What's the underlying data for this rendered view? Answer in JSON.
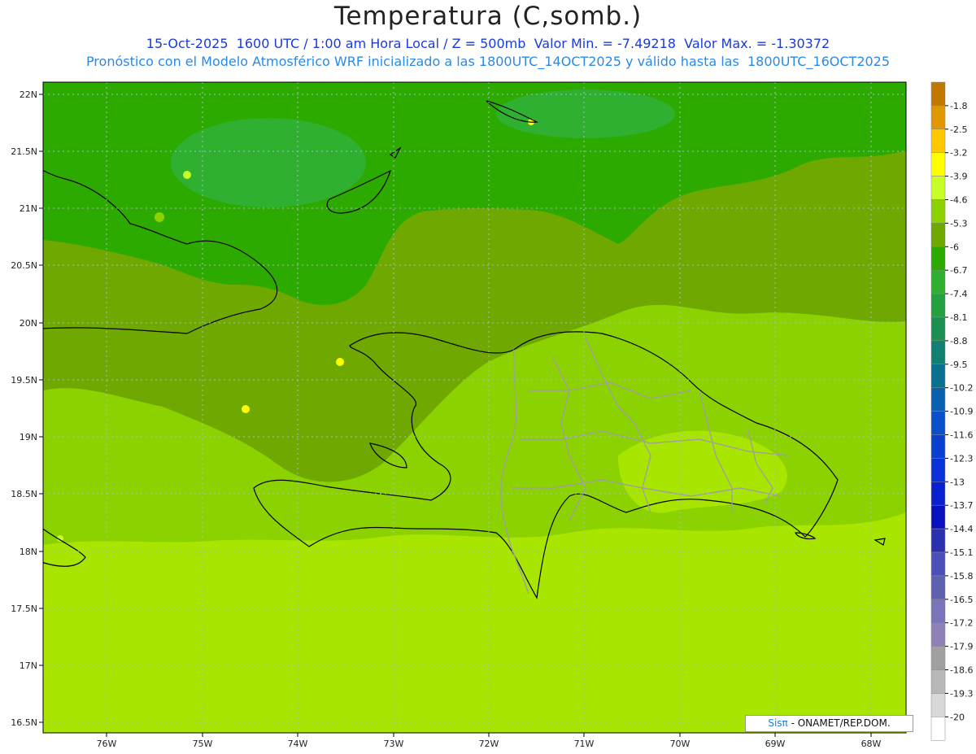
{
  "header": {
    "title": "Temperatura (C,somb.)",
    "line1": "15-Oct-2025  1600 UTC / 1:00 am Hora Local / Z = 500mb  Valor Min. = -7.49218  Valor Max. = -1.30372",
    "line2": "Pronóstico con el Modelo Atmosférico WRF inicializado a las 1800UTC_14OCT2025 y válido hasta las  1800UTC_16OCT2025"
  },
  "map": {
    "lat_labels": [
      "22N",
      "21.5N",
      "21N",
      "20.5N",
      "20N",
      "19.5N",
      "19N",
      "18.5N",
      "18N",
      "17.5N",
      "17N",
      "16.5N"
    ],
    "lon_labels": [
      "76W",
      "75W",
      "74W",
      "73W",
      "72W",
      "71W",
      "70W",
      "69W",
      "68W"
    ],
    "credit_brand": "Sisπ",
    "credit_text": " - ONAMET/REP.DOM."
  },
  "colorbar": {
    "labels": [
      "-1.8",
      "-2.5",
      "-3.2",
      "-3.9",
      "-4.6",
      "-5.3",
      "-6",
      "-6.7",
      "-7.4",
      "-8.1",
      "-8.8",
      "-9.5",
      "-10.2",
      "-10.9",
      "-11.6",
      "-12.3",
      "-13",
      "-13.7",
      "-14.4",
      "-15.1",
      "-15.8",
      "-16.5",
      "-17.2",
      "-17.9",
      "-18.6",
      "-19.3",
      "-20"
    ],
    "colors": [
      "#c07800",
      "#e09800",
      "#ffc800",
      "#ffff00",
      "#c8ff28",
      "#8cd200",
      "#6ea800",
      "#2caa00",
      "#30b030",
      "#24a040",
      "#1c9050",
      "#108070",
      "#0a7090",
      "#0a60b0",
      "#0a50c8",
      "#0a40d0",
      "#0a30d8",
      "#0a20d0",
      "#0a10c0",
      "#2a30b0",
      "#4a50b8",
      "#6060b0",
      "#7a74b8",
      "#9080b8",
      "#a0a0a0",
      "#b8b8b8",
      "#d8d8d8",
      "#ffffff"
    ]
  }
}
